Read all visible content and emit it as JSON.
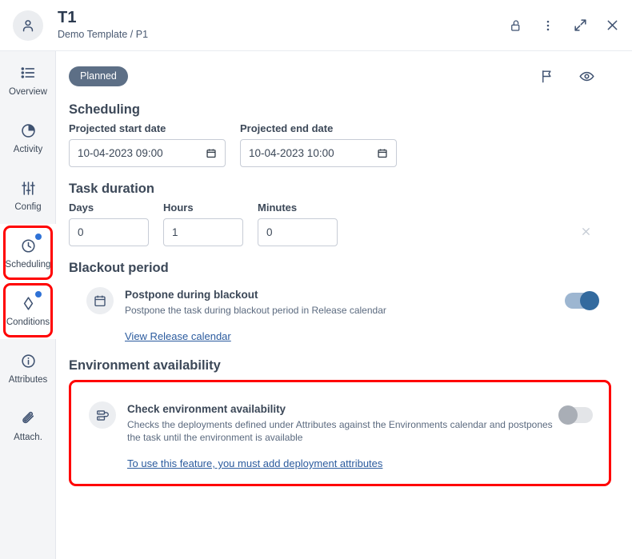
{
  "header": {
    "avatar_icon": "person-icon",
    "title": "T1",
    "subtitle": "Demo Template / P1",
    "actions": [
      {
        "name": "lock-icon",
        "label": "Lock"
      },
      {
        "name": "more-vertical-icon",
        "label": "More options"
      },
      {
        "name": "expand-icon",
        "label": "Expand"
      },
      {
        "name": "close-icon",
        "label": "Close"
      }
    ]
  },
  "sidebar": {
    "items": [
      {
        "label": "Overview",
        "icon": "list-icon",
        "badge": false,
        "highlighted": false
      },
      {
        "label": "Activity",
        "icon": "pie-clock-icon",
        "badge": false,
        "highlighted": false
      },
      {
        "label": "Config",
        "icon": "sliders-icon",
        "badge": false,
        "highlighted": false
      },
      {
        "label": "Scheduling",
        "icon": "clock-icon",
        "badge": true,
        "highlighted": true
      },
      {
        "label": "Conditions",
        "icon": "diamond-icon",
        "badge": true,
        "highlighted": true
      },
      {
        "label": "Attributes",
        "icon": "info-icon",
        "badge": false,
        "highlighted": false
      },
      {
        "label": "Attach.",
        "icon": "paperclip-icon",
        "badge": false,
        "highlighted": false
      }
    ]
  },
  "main": {
    "status_badge": "Planned",
    "top_actions": [
      {
        "name": "flag-icon",
        "label": "Flag"
      },
      {
        "name": "eye-icon",
        "label": "Watch"
      }
    ],
    "scheduling": {
      "title": "Scheduling",
      "start_label": "Projected start date",
      "start_value": "10-04-2023 09:00",
      "end_label": "Projected end date",
      "end_value": "10-04-2023 10:00"
    },
    "duration": {
      "title": "Task duration",
      "days_label": "Days",
      "days_value": "0",
      "hours_label": "Hours",
      "hours_value": "1",
      "minutes_label": "Minutes",
      "minutes_value": "0",
      "clear_icon": "close-icon"
    },
    "blackout": {
      "title": "Blackout period",
      "option_title": "Postpone during blackout",
      "option_desc": "Postpone the task during blackout period in Release calendar",
      "icon": "calendar-icon",
      "toggle_state": "on",
      "link": "View Release calendar"
    },
    "environment": {
      "title": "Environment availability",
      "option_title": "Check environment availability",
      "option_desc": "Checks the deployments defined under Attributes against the Environments calendar and postpones the task until the environment is available",
      "icon": "server-icon",
      "toggle_state": "off",
      "link": "To use this feature, you must add deployment attributes"
    }
  },
  "colors": {
    "accent": "#2f72d6",
    "status_badge_bg": "#5d6f86",
    "highlight_outline": "#ff0000",
    "toggle_on": "#336a9e",
    "link": "#2b5b9e",
    "sidebar_bg": "#f4f5f7"
  }
}
